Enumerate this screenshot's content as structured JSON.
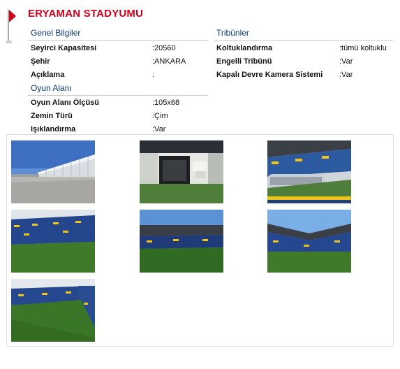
{
  "title": "ERYAMAN STADYUMU",
  "genel": {
    "heading": "Genel Bilgiler",
    "rows": [
      {
        "label": "Seyirci Kapasitesi",
        "value": ":20560"
      },
      {
        "label": "Şehir",
        "value": ":ANKARA"
      },
      {
        "label": "Açıklama",
        "value": ":"
      }
    ]
  },
  "oyun": {
    "heading": "Oyun Alanı",
    "rows": [
      {
        "label": "Oyun Alanı Ölçüsü",
        "value": ":105x68"
      },
      {
        "label": "Zemin Türü",
        "value": ":Çim"
      },
      {
        "label": "Işıklandırma",
        "value": ":Var"
      }
    ]
  },
  "tribunler": {
    "heading": "Tribünler",
    "rows": [
      {
        "label": "Koltuklandırma",
        "value": ":tümü koltuklu"
      },
      {
        "label": "Engelli Tribünü",
        "value": ":Var"
      },
      {
        "label": "Kapalı Devre Kamera Sistemi",
        "value": ":Var"
      }
    ]
  },
  "colors": {
    "title": "#d0021b",
    "heading": "#0b3a78",
    "grass": "#3f7a2c",
    "sky": "#6fa6e0"
  },
  "photos": [
    {
      "name": "photo-stadium-exterior"
    },
    {
      "name": "photo-tunnel-entrance"
    },
    {
      "name": "photo-stands-dugout"
    },
    {
      "name": "photo-field-view-1"
    },
    {
      "name": "photo-field-view-2"
    },
    {
      "name": "photo-field-view-3"
    },
    {
      "name": "photo-field-view-4"
    }
  ]
}
